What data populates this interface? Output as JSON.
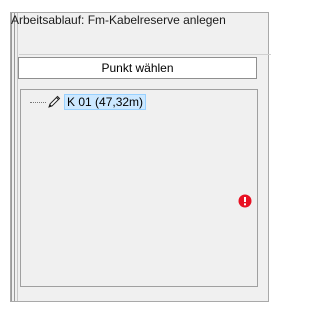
{
  "workflow": {
    "title": "Arbeitsablauf: Fm-Kabelreserve anlegen",
    "select_point_label": "Punkt wählen"
  },
  "tree": {
    "items": [
      {
        "label": "K 01 (47,32m)",
        "icon": "pencil-icon",
        "selected": true
      }
    ]
  },
  "status": {
    "error_icon": "error-icon",
    "error_color": "#e81123"
  },
  "colors": {
    "selection_bg": "#cce8ff",
    "selection_border": "#99d1ff",
    "panel_bg": "#f0f0f0"
  }
}
